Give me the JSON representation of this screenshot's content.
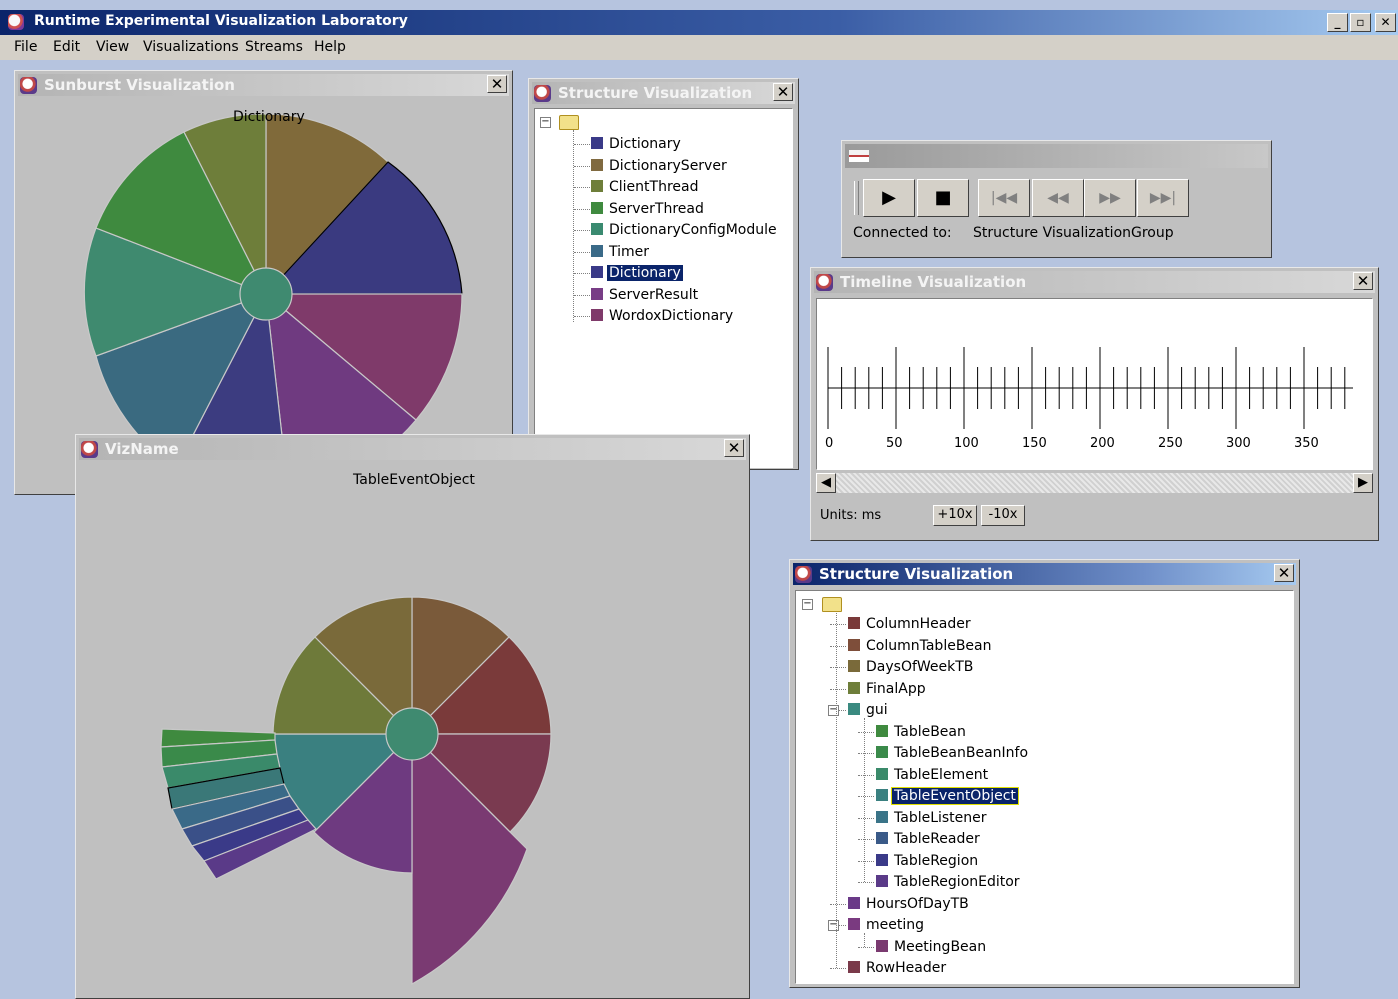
{
  "app": {
    "title": "Runtime Experimental Visualization Laboratory",
    "minimize": "_",
    "restore": "🗗",
    "close": "✕"
  },
  "menu": [
    "File",
    "Edit",
    "View",
    "Visualizations",
    "Streams",
    "Help"
  ],
  "sunburst": {
    "title": "Sunburst Visualization",
    "center_label": "Dictionary"
  },
  "structure1": {
    "title": "Structure Visualization",
    "items": [
      {
        "label": "Dictionary",
        "color": "#3a3a88"
      },
      {
        "label": "DictionaryServer",
        "color": "#806a40"
      },
      {
        "label": "ClientThread",
        "color": "#6e7e3a"
      },
      {
        "label": "ServerThread",
        "color": "#3f8a3f"
      },
      {
        "label": "DictionaryConfigModule",
        "color": "#3a8a70"
      },
      {
        "label": "Timer",
        "color": "#3a6a88"
      },
      {
        "label": "Dictionary",
        "color": "#3a3a88",
        "selected": true
      },
      {
        "label": "ServerResult",
        "color": "#783d86"
      },
      {
        "label": "WordoxDictionary",
        "color": "#7f3a6a"
      }
    ]
  },
  "player": {
    "connected_label": "Connected to:",
    "connected_value": "Structure VisualizationGroup"
  },
  "timeline": {
    "title": "Timeline Visualization",
    "ticks": [
      "0",
      "50",
      "100",
      "150",
      "200",
      "250",
      "300",
      "350"
    ],
    "units_label": "Units: ms",
    "zoom_in": "+10x",
    "zoom_out": "-10x"
  },
  "vizname": {
    "title": "VizName",
    "label": "TableEventObject"
  },
  "structure2": {
    "title": "Structure Visualization",
    "items": [
      {
        "label": "ColumnHeader",
        "color": "#7a3a3a",
        "level": 1
      },
      {
        "label": "ColumnTableBean",
        "color": "#7e4e3a",
        "level": 1
      },
      {
        "label": "DaysOfWeekTB",
        "color": "#7a6a3a",
        "level": 1
      },
      {
        "label": "FinalApp",
        "color": "#6e7e3a",
        "level": 1
      },
      {
        "label": "gui",
        "color": "#3a8a80",
        "level": 1,
        "expanded": true
      },
      {
        "label": "TableBean",
        "color": "#3f8a3f",
        "level": 2
      },
      {
        "label": "TableBeanBeanInfo",
        "color": "#3a8a4a",
        "level": 2
      },
      {
        "label": "TableElement",
        "color": "#3a8a6a",
        "level": 2
      },
      {
        "label": "TableEventObject",
        "color": "#3a8080",
        "level": 2,
        "selected": true
      },
      {
        "label": "TableListener",
        "color": "#3a7488",
        "level": 2
      },
      {
        "label": "TableReader",
        "color": "#3a5a88",
        "level": 2
      },
      {
        "label": "TableRegion",
        "color": "#3a3a88",
        "level": 2
      },
      {
        "label": "TableRegionEditor",
        "color": "#5a3a88",
        "level": 2
      },
      {
        "label": "HoursOfDayTB",
        "color": "#6a3a88",
        "level": 1
      },
      {
        "label": "meeting",
        "color": "#7a3a80",
        "level": 1,
        "expanded": true
      },
      {
        "label": "MeetingBean",
        "color": "#7a3a70",
        "level": 2
      },
      {
        "label": "RowHeader",
        "color": "#7a3a4a",
        "level": 1
      }
    ]
  }
}
